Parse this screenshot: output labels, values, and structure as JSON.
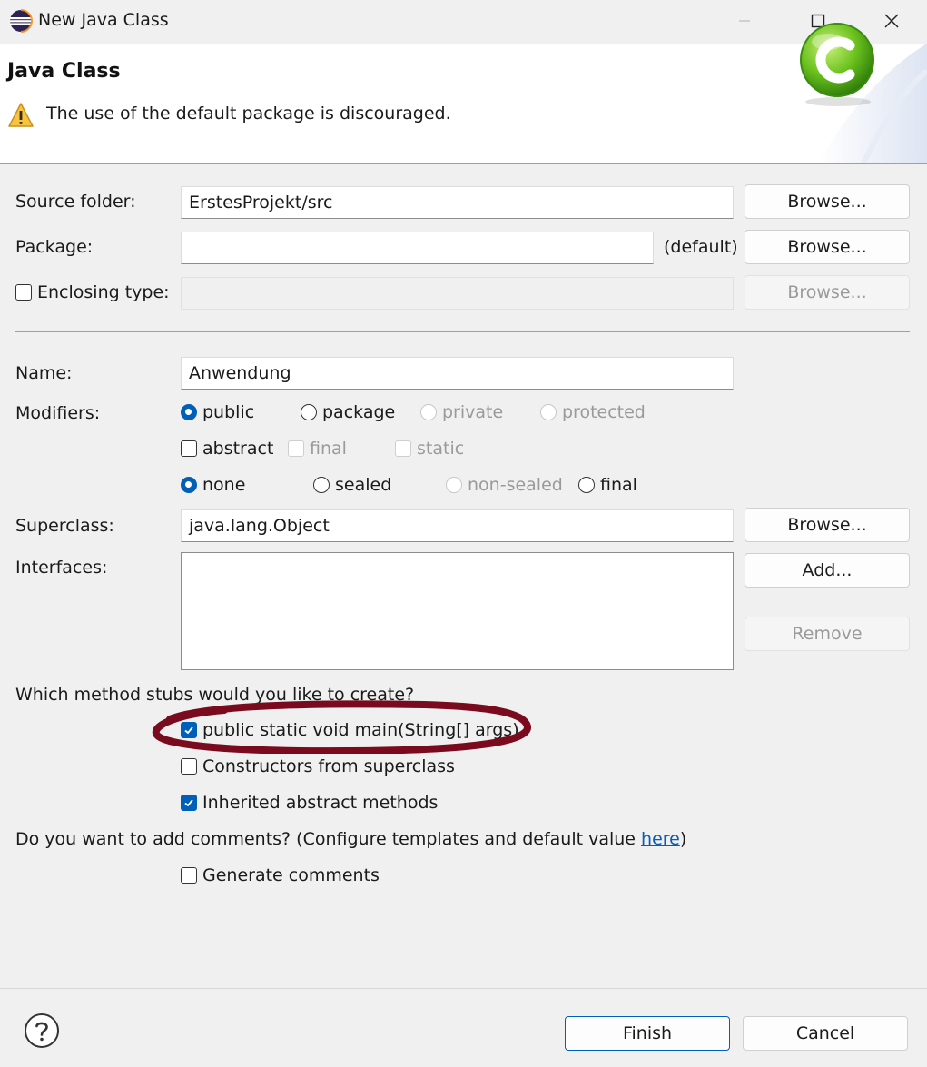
{
  "window": {
    "title": "New Java Class"
  },
  "header": {
    "title": "Java Class",
    "warning": "The use of the default package is discouraged."
  },
  "form": {
    "source_folder": {
      "label": "Source folder:",
      "value": "ErstesProjekt/src",
      "browse": "Browse..."
    },
    "package": {
      "label": "Package:",
      "value": "",
      "default_note": "(default)",
      "browse": "Browse..."
    },
    "enclosing_type": {
      "label": "Enclosing type:",
      "checked": false,
      "value": "",
      "browse": "Browse..."
    },
    "name": {
      "label": "Name:",
      "value": "Anwendung"
    },
    "modifiers": {
      "label": "Modifiers:",
      "access": [
        {
          "label": "public",
          "selected": true,
          "enabled": true
        },
        {
          "label": "package",
          "selected": false,
          "enabled": true
        },
        {
          "label": "private",
          "selected": false,
          "enabled": false
        },
        {
          "label": "protected",
          "selected": false,
          "enabled": false
        }
      ],
      "flags": [
        {
          "label": "abstract",
          "checked": false,
          "enabled": true
        },
        {
          "label": "final",
          "checked": false,
          "enabled": false
        },
        {
          "label": "static",
          "checked": false,
          "enabled": false
        }
      ],
      "sealing": [
        {
          "label": "none",
          "selected": true,
          "enabled": true
        },
        {
          "label": "sealed",
          "selected": false,
          "enabled": true
        },
        {
          "label": "non-sealed",
          "selected": false,
          "enabled": false
        },
        {
          "label": "final",
          "selected": false,
          "enabled": true
        }
      ]
    },
    "superclass": {
      "label": "Superclass:",
      "value": "java.lang.Object",
      "browse": "Browse..."
    },
    "interfaces": {
      "label": "Interfaces:",
      "add": "Add...",
      "remove": "Remove"
    },
    "stubs": {
      "question": "Which method stubs would you like to create?",
      "options": [
        {
          "label": "public static void main(String[] args)",
          "checked": true
        },
        {
          "label": "Constructors from superclass",
          "checked": false
        },
        {
          "label": "Inherited abstract methods",
          "checked": true
        }
      ]
    },
    "comments": {
      "question_prefix": "Do you want to add comments? (Configure templates and default value ",
      "link": "here",
      "question_suffix": ")",
      "option": {
        "label": "Generate comments",
        "checked": false
      }
    }
  },
  "footer": {
    "finish": "Finish",
    "cancel": "Cancel"
  },
  "colors": {
    "accent": "#005fb8",
    "annotation": "#7a0a1e",
    "link": "#0a5db3"
  },
  "icons": [
    "eclipse-icon",
    "minimize-icon",
    "maximize-icon",
    "close-icon",
    "warning-icon",
    "java-class-icon",
    "help-icon"
  ]
}
